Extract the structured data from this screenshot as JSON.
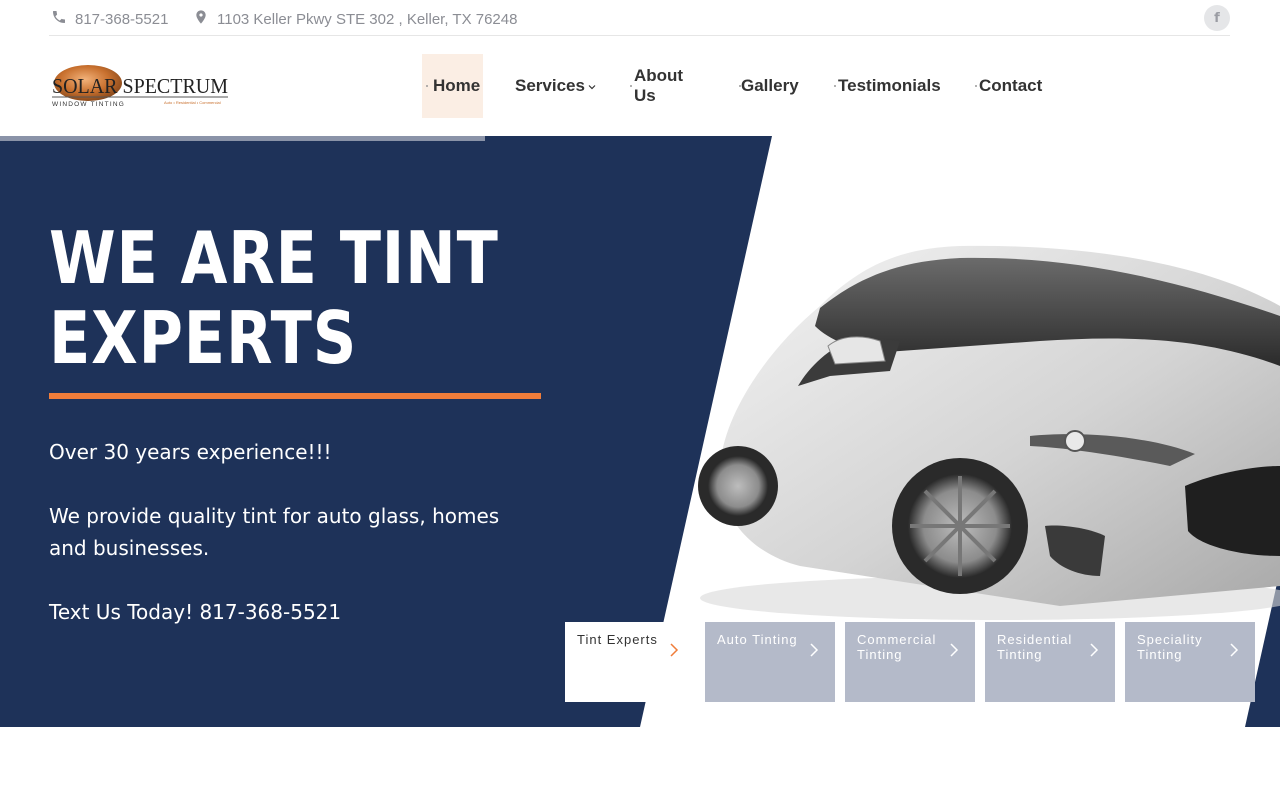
{
  "topbar": {
    "phone": "817-368-5521",
    "address": "1103 Keller Pkwy STE 302 , Keller, TX 76248",
    "facebook_icon": "f"
  },
  "logo": {
    "brand": "SOLAR SPECTRUM",
    "tagline": "WINDOW TINTING",
    "subline": "Auto • Residential • Commercial"
  },
  "nav": {
    "items": [
      {
        "label": "Home",
        "active": true
      },
      {
        "label": "Services",
        "has_dropdown": true
      },
      {
        "label": "About Us"
      },
      {
        "label": "Gallery"
      },
      {
        "label": "Testimonials"
      },
      {
        "label": "Contact"
      }
    ]
  },
  "hero": {
    "headline_line1": "WE ARE TINT",
    "headline_line2": "EXPERTS",
    "experience": "Over 30 years experience!!!",
    "description": "We provide quality tint for auto glass, homes and businesses.",
    "cta": "Text Us Today! 817-368-5521"
  },
  "tiles": [
    {
      "label": "Tint Experts",
      "active": true
    },
    {
      "label": "Auto Tinting"
    },
    {
      "label": "Commercial Tinting"
    },
    {
      "label": "Residential Tinting"
    },
    {
      "label": "Speciality Tinting"
    }
  ],
  "colors": {
    "navy": "#1e3259",
    "accent_orange": "#f07d3a",
    "nav_active_bg": "#fbeee4",
    "tile_bg": "#b4bac9"
  }
}
